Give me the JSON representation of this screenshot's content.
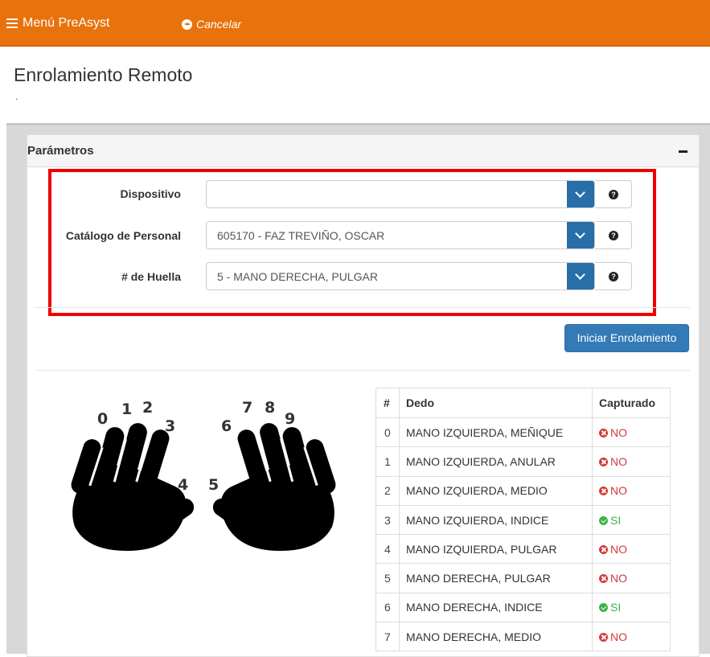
{
  "topbar": {
    "menu_label": "Menú PreAsyst",
    "cancel_label": "Cancelar",
    "color": "#e8720c"
  },
  "page": {
    "title": "Enrolamiento Remoto",
    "subtitle": "."
  },
  "panel": {
    "title": "Parámetros",
    "fields": [
      {
        "label": "Dispositivo",
        "value": ""
      },
      {
        "label": "Catálogo de Personal",
        "value": "605170 - FAZ TREVIÑO, OSCAR"
      },
      {
        "label": "# de Huella",
        "value": "5 - MANO DERECHA, PULGAR"
      }
    ],
    "start_button": "Iniciar Enrolamiento"
  },
  "hand_digits": [
    "0",
    "1",
    "2",
    "3",
    "4",
    "5",
    "6",
    "7",
    "8",
    "9"
  ],
  "table": {
    "headers": [
      "#",
      "Dedo",
      "Capturado"
    ],
    "rows": [
      {
        "num": "0",
        "finger": "MANO IZQUIERDA, MEÑIQUE",
        "captured": "NO"
      },
      {
        "num": "1",
        "finger": "MANO IZQUIERDA, ANULAR",
        "captured": "NO"
      },
      {
        "num": "2",
        "finger": "MANO IZQUIERDA, MEDIO",
        "captured": "NO"
      },
      {
        "num": "3",
        "finger": "MANO IZQUIERDA, INDICE",
        "captured": "SI"
      },
      {
        "num": "4",
        "finger": "MANO IZQUIERDA, PULGAR",
        "captured": "NO"
      },
      {
        "num": "5",
        "finger": "MANO DERECHA, PULGAR",
        "captured": "NO"
      },
      {
        "num": "6",
        "finger": "MANO DERECHA, INDICE",
        "captured": "SI"
      },
      {
        "num": "7",
        "finger": "MANO DERECHA, MEDIO",
        "captured": "NO"
      }
    ]
  },
  "colors": {
    "primary": "#337ab7",
    "dropdown": "#286ea8",
    "no": "#d43a3a",
    "si": "#3cb24a",
    "highlight": "#ee0000"
  }
}
